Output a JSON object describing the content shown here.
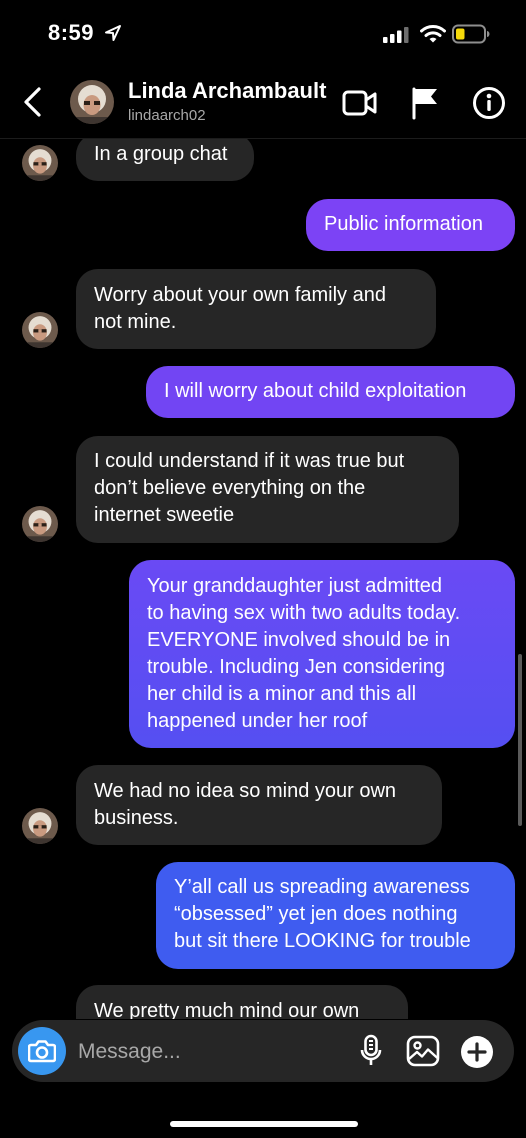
{
  "status_bar": {
    "time": "8:59",
    "icons": [
      "location-arrow-icon",
      "signal-icon",
      "wifi-icon",
      "battery-low-icon"
    ],
    "battery_color": "#f5d90a"
  },
  "header": {
    "name": "Linda Archambault",
    "username": "lindaarch02",
    "icons": [
      "back-chevron-icon",
      "video-call-icon",
      "flag-icon",
      "info-icon"
    ]
  },
  "messages": [
    {
      "sender": "them",
      "text": "In a group chat"
    },
    {
      "sender": "me",
      "text": "Public information"
    },
    {
      "sender": "them",
      "text": "Worry about your own family and\nnot mine."
    },
    {
      "sender": "me",
      "text": "I will worry about child exploitation"
    },
    {
      "sender": "them",
      "text": "I could understand if it was true but\ndon’t believe everything on the\ninternet sweetie"
    },
    {
      "sender": "me",
      "text": "Your granddaughter just admitted\nto having sex with two adults today.\nEVERYONE involved should be in\ntrouble. Including Jen considering\nher child is a minor and this all\nhappened under her roof"
    },
    {
      "sender": "them",
      "text": "We had no idea so mind your own\nbusiness."
    },
    {
      "sender": "me",
      "text": "Y’all call us spreading awareness\n“obsessed” yet jen does nothing\nbut sit there LOOKING for trouble"
    },
    {
      "sender": "them",
      "text": "We pretty much mind our own"
    }
  ],
  "composer": {
    "placeholder": "Message...",
    "icons": [
      "camera-icon",
      "microphone-icon",
      "gallery-icon",
      "plus-icon"
    ]
  },
  "colors": {
    "background": "#000000",
    "incoming_bubble": "#262626",
    "outgoing_gradient_top": "#8a3ffc",
    "outgoing_gradient_bottom": "#3a63f0",
    "camera_button": "#3897f0"
  }
}
